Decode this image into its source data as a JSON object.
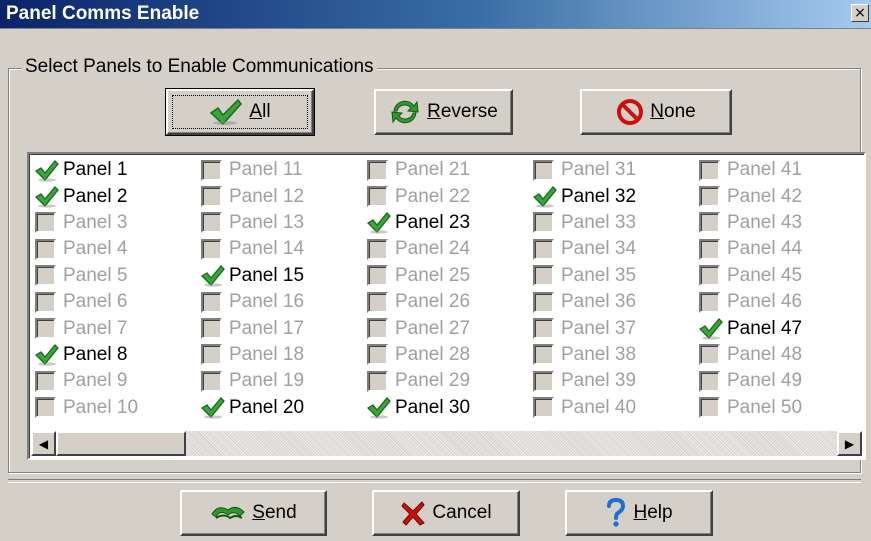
{
  "window": {
    "title": "Panel Comms Enable",
    "close_label": "×"
  },
  "group": {
    "label": "Select Panels to Enable Communications"
  },
  "top_buttons": {
    "all": {
      "label_underlined": "A",
      "label_rest": "ll",
      "icon": "check-icon"
    },
    "reverse": {
      "label_underlined": "R",
      "label_rest": "everse",
      "icon": "refresh-icon"
    },
    "none": {
      "label_underlined": "N",
      "label_rest": "one",
      "icon": "no-entry-icon"
    }
  },
  "panels": [
    {
      "label": "Panel 1",
      "checked": true
    },
    {
      "label": "Panel 2",
      "checked": true
    },
    {
      "label": "Panel 3",
      "checked": false
    },
    {
      "label": "Panel 4",
      "checked": false
    },
    {
      "label": "Panel 5",
      "checked": false
    },
    {
      "label": "Panel 6",
      "checked": false
    },
    {
      "label": "Panel 7",
      "checked": false
    },
    {
      "label": "Panel 8",
      "checked": true
    },
    {
      "label": "Panel 9",
      "checked": false
    },
    {
      "label": "Panel 10",
      "checked": false
    },
    {
      "label": "Panel 11",
      "checked": false
    },
    {
      "label": "Panel 12",
      "checked": false
    },
    {
      "label": "Panel 13",
      "checked": false
    },
    {
      "label": "Panel 14",
      "checked": false
    },
    {
      "label": "Panel 15",
      "checked": true
    },
    {
      "label": "Panel 16",
      "checked": false
    },
    {
      "label": "Panel 17",
      "checked": false
    },
    {
      "label": "Panel 18",
      "checked": false
    },
    {
      "label": "Panel 19",
      "checked": false
    },
    {
      "label": "Panel 20",
      "checked": true
    },
    {
      "label": "Panel 21",
      "checked": false
    },
    {
      "label": "Panel 22",
      "checked": false
    },
    {
      "label": "Panel 23",
      "checked": true
    },
    {
      "label": "Panel 24",
      "checked": false
    },
    {
      "label": "Panel 25",
      "checked": false
    },
    {
      "label": "Panel 26",
      "checked": false
    },
    {
      "label": "Panel 27",
      "checked": false
    },
    {
      "label": "Panel 28",
      "checked": false
    },
    {
      "label": "Panel 29",
      "checked": false
    },
    {
      "label": "Panel 30",
      "checked": true
    },
    {
      "label": "Panel 31",
      "checked": false
    },
    {
      "label": "Panel 32",
      "checked": true
    },
    {
      "label": "Panel 33",
      "checked": false
    },
    {
      "label": "Panel 34",
      "checked": false
    },
    {
      "label": "Panel 35",
      "checked": false
    },
    {
      "label": "Panel 36",
      "checked": false
    },
    {
      "label": "Panel 37",
      "checked": false
    },
    {
      "label": "Panel 38",
      "checked": false
    },
    {
      "label": "Panel 39",
      "checked": false
    },
    {
      "label": "Panel 40",
      "checked": false
    },
    {
      "label": "Panel 41",
      "checked": false
    },
    {
      "label": "Panel 42",
      "checked": false
    },
    {
      "label": "Panel 43",
      "checked": false
    },
    {
      "label": "Panel 44",
      "checked": false
    },
    {
      "label": "Panel 45",
      "checked": false
    },
    {
      "label": "Panel 46",
      "checked": false
    },
    {
      "label": "Panel 47",
      "checked": true
    },
    {
      "label": "Panel 48",
      "checked": false
    },
    {
      "label": "Panel 49",
      "checked": false
    },
    {
      "label": "Panel 50",
      "checked": false
    }
  ],
  "scrollbar": {
    "left_arrow": "◀",
    "right_arrow": "▶"
  },
  "bottom_buttons": {
    "send": {
      "label_underlined": "S",
      "label_rest": "end",
      "icon": "send-icon"
    },
    "cancel": {
      "label_underlined": "",
      "label_rest": "Cancel",
      "icon": "x-icon"
    },
    "help": {
      "label_underlined": "H",
      "label_rest": "elp",
      "icon": "question-icon"
    }
  },
  "colors": {
    "check": "#3aa53a",
    "check_dark": "#1a6b1a",
    "disabled_text": "#a0a0a0",
    "title_start": "#0a246a",
    "title_end": "#a6caf0"
  }
}
